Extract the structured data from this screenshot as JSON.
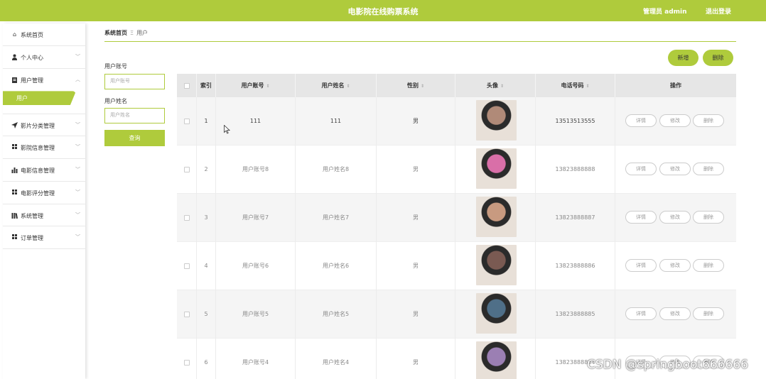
{
  "header": {
    "title": "电影院在线购票系统",
    "admin": "管理员 admin",
    "logout": "退出登录"
  },
  "sidebar": {
    "items": [
      {
        "label": "系统首页",
        "icon": "home-icon"
      },
      {
        "label": "个人中心",
        "icon": "user-icon"
      },
      {
        "label": "用户管理",
        "icon": "clipboard-icon"
      },
      {
        "label": "影片分类管理",
        "icon": "send-icon"
      },
      {
        "label": "影院信息管理",
        "icon": "grid-icon"
      },
      {
        "label": "电影信息管理",
        "icon": "bar-chart-icon"
      },
      {
        "label": "电影评分管理",
        "icon": "grid-icon"
      },
      {
        "label": "系统管理",
        "icon": "library-icon"
      },
      {
        "label": "订单管理",
        "icon": "grid-icon"
      }
    ],
    "sub_active": "用户"
  },
  "breadcrumb": {
    "home": "系统首页",
    "sep": "Ξ",
    "current": "用户"
  },
  "search": {
    "account_label": "用户账号",
    "account_placeholder": "用户账号",
    "name_label": "用户姓名",
    "name_placeholder": "用户姓名",
    "query": "查询"
  },
  "actions": {
    "add": "新增",
    "delete": "删除"
  },
  "table": {
    "headers": [
      "索引",
      "用户账号",
      "用户姓名",
      "性别",
      "头像",
      "电话号码",
      "操作"
    ],
    "row_buttons": [
      "详情",
      "修改",
      "删除"
    ],
    "rows": [
      {
        "index": "1",
        "account": "111",
        "name": "111",
        "gender": "男",
        "phone": "13513513555",
        "avatar_color": "#b08a78"
      },
      {
        "index": "2",
        "account": "用户账号8",
        "name": "用户姓名8",
        "gender": "男",
        "phone": "13823888888",
        "avatar_color": "#d96fa8"
      },
      {
        "index": "3",
        "account": "用户账号7",
        "name": "用户姓名7",
        "gender": "男",
        "phone": "13823888887",
        "avatar_color": "#c89a80"
      },
      {
        "index": "4",
        "account": "用户账号6",
        "name": "用户姓名6",
        "gender": "男",
        "phone": "13823888886",
        "avatar_color": "#7a5a52"
      },
      {
        "index": "5",
        "account": "用户账号5",
        "name": "用户姓名5",
        "gender": "男",
        "phone": "13823888885",
        "avatar_color": "#4f6f88"
      },
      {
        "index": "6",
        "account": "用户账号4",
        "name": "用户姓名4",
        "gender": "男",
        "phone": "13823888884",
        "avatar_color": "#9b7fb3"
      }
    ]
  },
  "watermark": "CSDN @springboot666666",
  "colors": {
    "accent": "#afcb3c"
  }
}
